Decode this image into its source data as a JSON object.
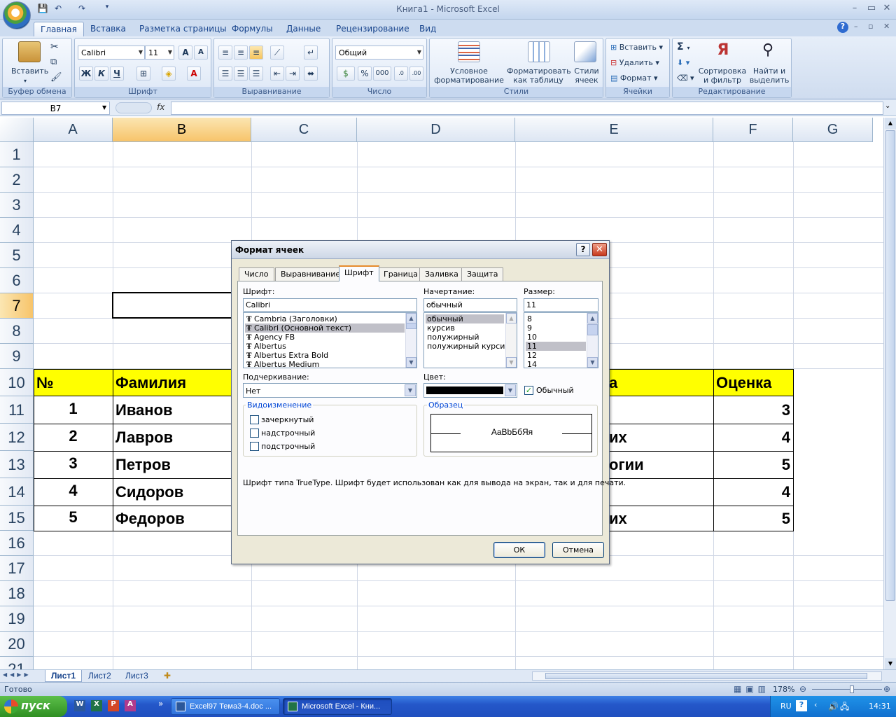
{
  "window": {
    "title": "Книга1 - Microsoft Excel"
  },
  "ribbon": {
    "tabs": [
      "Главная",
      "Вставка",
      "Разметка страницы",
      "Формулы",
      "Данные",
      "Рецензирование",
      "Вид"
    ],
    "active_tab": "Главная",
    "clipboard": {
      "paste": "Вставить",
      "group": "Буфер обмена"
    },
    "font": {
      "name": "Calibri",
      "size": "11",
      "group": "Шрифт",
      "bold": "Ж",
      "italic": "К",
      "underline": "Ч"
    },
    "alignment": {
      "group": "Выравнивание"
    },
    "number": {
      "format": "Общий",
      "group": "Число",
      "percent": "%",
      "thousands": "000"
    },
    "styles": {
      "conditional": "Условное",
      "conditional2": "форматирование",
      "as_table": "Форматировать",
      "as_table2": "как таблицу",
      "cell_styles": "Стили",
      "cell_styles2": "ячеек",
      "group": "Стили"
    },
    "cells": {
      "insert": "Вставить",
      "delete": "Удалить",
      "format": "Формат",
      "group": "Ячейки"
    },
    "editing": {
      "sum": "Σ",
      "sort": "Сортировка",
      "sort2": "и фильтр",
      "find": "Найти и",
      "find2": "выделить",
      "group": "Редактирование"
    }
  },
  "formula_bar": {
    "name_box": "B7",
    "fx": "fx",
    "value": ""
  },
  "grid": {
    "columns": [
      "A",
      "B",
      "C",
      "D",
      "E",
      "F",
      "G"
    ],
    "selected_column": "B",
    "rows": [
      "1",
      "2",
      "3",
      "4",
      "5",
      "6",
      "7",
      "8",
      "9",
      "10",
      "11",
      "12",
      "13",
      "14",
      "15",
      "16",
      "17",
      "18",
      "19",
      "20",
      "21"
    ],
    "selected_row": "7",
    "table_header": {
      "num": "№",
      "surname": "Фамилия",
      "e": "а",
      "grade": "Оценка"
    },
    "table_rows": [
      {
        "num": "1",
        "surname": "Иванов",
        "e": "",
        "grade": "3"
      },
      {
        "num": "2",
        "surname": "Лавров",
        "e": "их",
        "grade": "4"
      },
      {
        "num": "3",
        "surname": "Петров",
        "e": "огии",
        "grade": "5"
      },
      {
        "num": "4",
        "surname": "Сидоров",
        "e": "",
        "grade": "4"
      },
      {
        "num": "5",
        "surname": "Федоров",
        "e": "их",
        "grade": "5"
      }
    ]
  },
  "sheets": {
    "tabs": [
      "Лист1",
      "Лист2",
      "Лист3"
    ],
    "active": "Лист1"
  },
  "status": {
    "ready": "Готово",
    "zoom": "178%"
  },
  "taskbar": {
    "start": "пуск",
    "items": [
      "Excel97 Тема3-4.doc ...",
      "Microsoft Excel - Кни..."
    ],
    "lang": "RU",
    "clock": "14:31"
  },
  "dialog": {
    "title": "Формат ячеек",
    "tabs": [
      "Число",
      "Выравнивание",
      "Шрифт",
      "Граница",
      "Заливка",
      "Защита"
    ],
    "active_tab": "Шрифт",
    "font_label": "Шрифт:",
    "font_value": "Calibri",
    "font_list": [
      "Cambria (Заголовки)",
      "Calibri (Основной текст)",
      "Agency FB",
      "Albertus",
      "Albertus Extra Bold",
      "Albertus Medium"
    ],
    "font_selected": "Calibri (Основной текст)",
    "style_label": "Начертание:",
    "style_value": "обычный",
    "style_list": [
      "обычный",
      "курсив",
      "полужирный",
      "полужирный курсив"
    ],
    "style_selected": "обычный",
    "size_label": "Размер:",
    "size_value": "11",
    "size_list": [
      "8",
      "9",
      "10",
      "11",
      "12",
      "14"
    ],
    "size_selected": "11",
    "underline_label": "Подчеркивание:",
    "underline_value": "Нет",
    "color_label": "Цвет:",
    "color_value": "#000000",
    "normal_label": "Обычный",
    "normal_checked": true,
    "effects_label": "Видоизменение",
    "strike_label": "зачеркнутый",
    "super_label": "надстрочный",
    "sub_label": "подстрочный",
    "preview_label": "Образец",
    "preview_text": "AaBbБбЯя",
    "info": "Шрифт типа TrueType. Шрифт будет использован как для вывода на экран, так и для печати.",
    "ok": "ОК",
    "cancel": "Отмена"
  },
  "colors": {
    "accent": "#15428b",
    "header_fill": "#ffff00",
    "selection_header": "#f7c46a"
  }
}
